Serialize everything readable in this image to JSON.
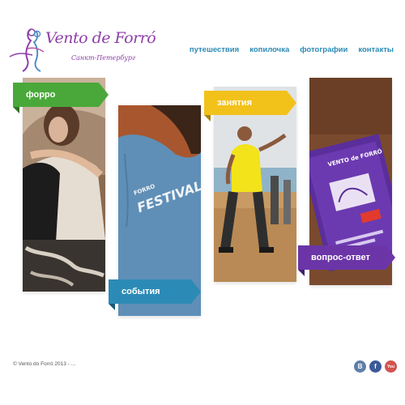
{
  "logo": {
    "title": "Vento de Forró",
    "subtitle": "Санкт-Петербург",
    "color": "#8e3fa8"
  },
  "nav": {
    "items": [
      {
        "label": "путешествия"
      },
      {
        "label": "копилочка"
      },
      {
        "label": "фотографии"
      },
      {
        "label": "контакты"
      }
    ],
    "color": "#2c8bb6"
  },
  "tiles": [
    {
      "label": "форро",
      "color": "#4aa83a",
      "image": "dancing-couple-photo"
    },
    {
      "label": "события",
      "color": "#2c8bb6",
      "image": "festival-tshirt-photo"
    },
    {
      "label": "занятия",
      "color": "#f2c21b",
      "image": "dance-class-photo"
    },
    {
      "label": "вопрос-ответ",
      "color": "#6b35a8",
      "image": "festival-flyers-photo"
    }
  ],
  "photo_text": {
    "tshirt_small": "FORRO",
    "tshirt_big": "FESTIVAL",
    "flyer": "VENTO de FORRÓ"
  },
  "footer": {
    "copyright": "© Vento do Forró 2013 - ..."
  },
  "social": [
    {
      "label": "B",
      "icon": "vkontakte-icon",
      "color": "#5f7fa8"
    },
    {
      "label": "f",
      "icon": "facebook-icon",
      "color": "#3b5a98"
    },
    {
      "label": "You",
      "icon": "youtube-icon",
      "color": "#d2534f"
    }
  ]
}
